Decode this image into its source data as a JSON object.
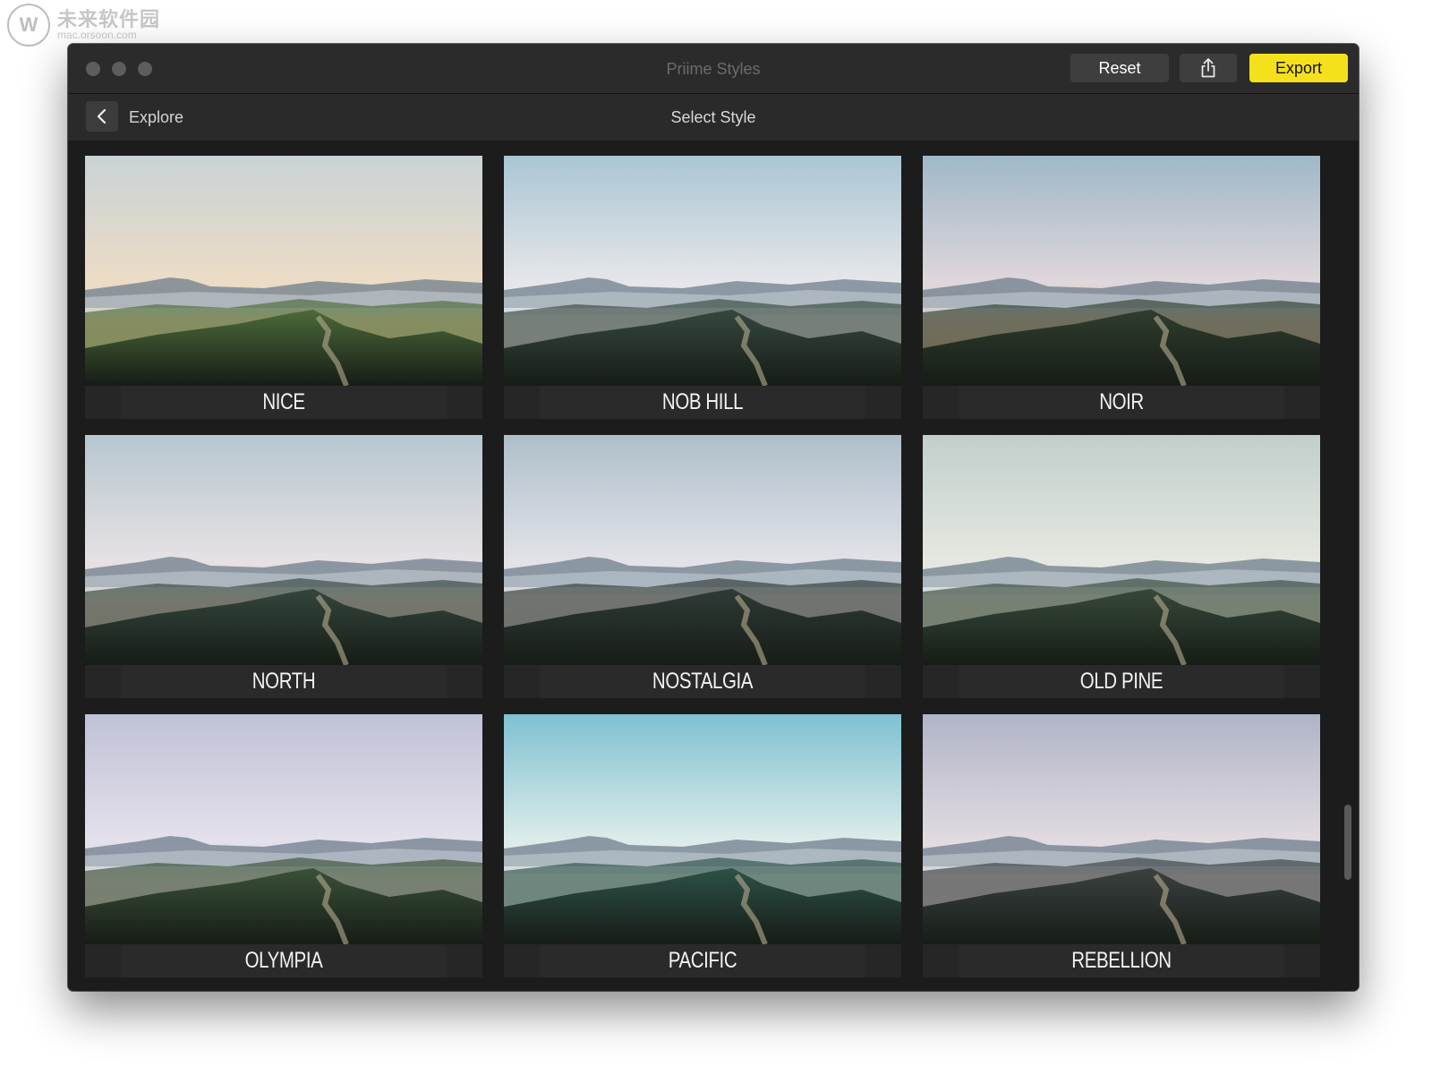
{
  "watermark": {
    "title": "未来软件园",
    "url": "mac.orsoon.com"
  },
  "window": {
    "app_title": "Priime Styles",
    "reset_label": "Reset",
    "share_icon": "share-icon",
    "export_label": "Export",
    "accent_color": "#f4e11b"
  },
  "nav": {
    "back_label": "Explore",
    "title": "Select Style"
  },
  "styles": [
    {
      "name": "NICE",
      "palette": [
        "#c9d3d6",
        "#ecdcc6",
        "#f3c591"
      ],
      "land_tint": "#4c6a3a"
    },
    {
      "name": "NOB HILL",
      "palette": [
        "#a9c6d3",
        "#e6e6ea",
        "#f3e6e3"
      ],
      "land_tint": "#35483d"
    },
    {
      "name": "NOIR",
      "palette": [
        "#9fb8c8",
        "#dfd7db",
        "#eab98d"
      ],
      "land_tint": "#2f3d2f"
    },
    {
      "name": "NORTH",
      "palette": [
        "#b6c7cf",
        "#e6e1e4",
        "#ecc0b0"
      ],
      "land_tint": "#34463c"
    },
    {
      "name": "NOSTALGIA",
      "palette": [
        "#aebfca",
        "#e2e2e8",
        "#ecd8d0"
      ],
      "land_tint": "#2f3b36"
    },
    {
      "name": "OLD PINE",
      "palette": [
        "#c1cfcc",
        "#e5e8e0",
        "#eee8d8"
      ],
      "land_tint": "#37493a"
    },
    {
      "name": "OLYMPIA",
      "palette": [
        "#bfc2d6",
        "#e4e0ec",
        "#ecd2d2"
      ],
      "land_tint": "#3a5138"
    },
    {
      "name": "PACIFIC",
      "palette": [
        "#7fc1d1",
        "#dcecea",
        "#f1e5d8"
      ],
      "land_tint": "#2d5148"
    },
    {
      "name": "REBELLION",
      "palette": [
        "#b0b4c8",
        "#e1dbe0",
        "#edd9d7"
      ],
      "land_tint": "#3b4140"
    }
  ]
}
